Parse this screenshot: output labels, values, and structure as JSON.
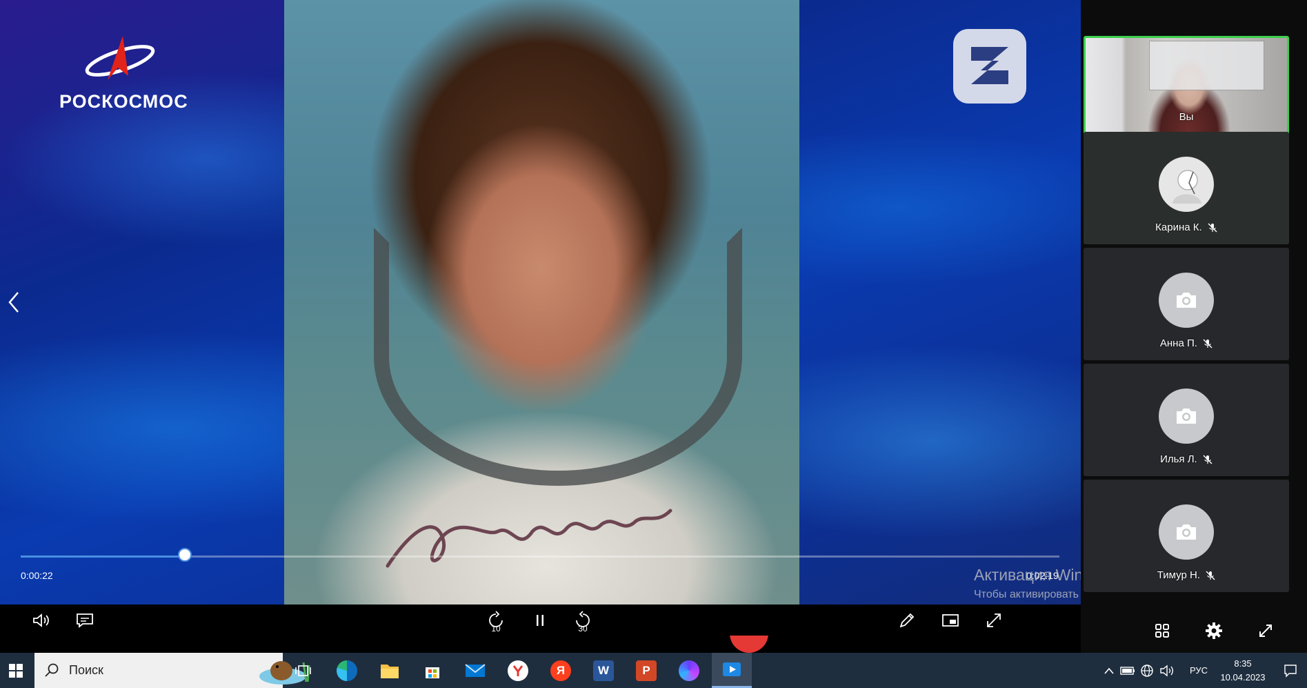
{
  "presentation": {
    "brand_text": "РОСКОСМОС",
    "accent_color": "#e2231a",
    "progress": {
      "current": "0:00:22",
      "total": "0:02:19",
      "fraction": 0.158
    }
  },
  "controls": {
    "volume": "volume-icon",
    "captions": "captions-icon",
    "rewind_seconds": "10",
    "forward_seconds": "30",
    "pause": "pause-icon",
    "annotate": "pencil-icon",
    "picture_in_picture": "pip-icon",
    "fullscreen": "expand-icon"
  },
  "watermark": {
    "title": "Активация Windows",
    "subtitle": "Чтобы активировать Windows, перейдите в раздел \"Параметры\"."
  },
  "participants": [
    {
      "name": "Вы",
      "self": true,
      "muted": false
    },
    {
      "name": "Карина К.",
      "self": false,
      "muted": true
    },
    {
      "name": "Анна П.",
      "self": false,
      "muted": true
    },
    {
      "name": "Илья Л.",
      "self": false,
      "muted": true
    },
    {
      "name": "Тимур Н.",
      "self": false,
      "muted": true
    }
  ],
  "panel_controls": [
    "grid-icon",
    "gear-icon",
    "expand-icon"
  ],
  "taskbar": {
    "search_placeholder": "Поиск",
    "apps": [
      "task-view",
      "edge",
      "file-explorer",
      "store",
      "mail",
      "yandex-browser",
      "yandex",
      "word",
      "powerpoint",
      "alice",
      "media-player"
    ],
    "word_letter": "W",
    "powerpoint_letter": "P",
    "yandex_letter": "Я",
    "language": "РУС",
    "time": "8:35",
    "date": "10.04.2023"
  }
}
